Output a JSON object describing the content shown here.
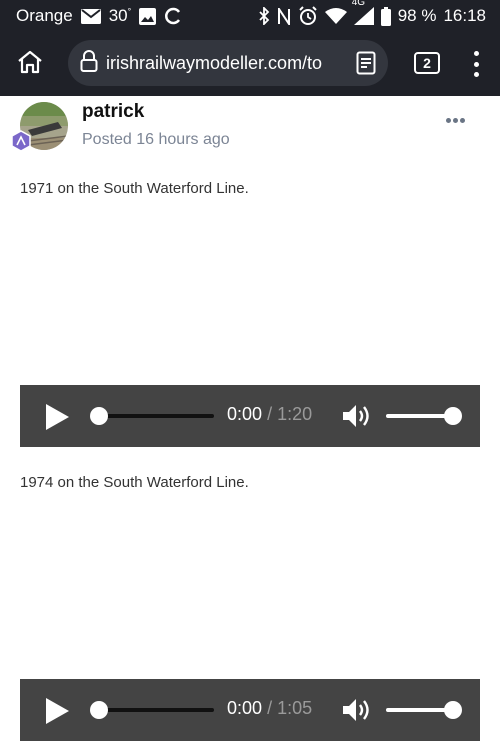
{
  "status_bar": {
    "carrier": "Orange",
    "temperature": "30",
    "network": "4G",
    "battery": "98 %",
    "time": "16:18",
    "icons": [
      "mail-icon",
      "gallery-icon",
      "sync-icon",
      "bluetooth-icon",
      "nfc-icon",
      "alarm-icon",
      "wifi-icon",
      "signal-icon",
      "battery-icon"
    ]
  },
  "browser": {
    "url": "irishrailwaymodeller.com/to",
    "tab_count": "2"
  },
  "post": {
    "author": "patrick",
    "posted": "Posted 16 hours ago"
  },
  "content": {
    "para1": "1971 on the South Waterford Line.",
    "para2": "1974 on the South Waterford Line."
  },
  "players": [
    {
      "current": "0:00",
      "separator": "/",
      "duration": "1:20",
      "progress": 0,
      "volume": 1
    },
    {
      "current": "0:00",
      "separator": "/",
      "duration": "1:05",
      "progress": 0,
      "volume": 1
    }
  ]
}
